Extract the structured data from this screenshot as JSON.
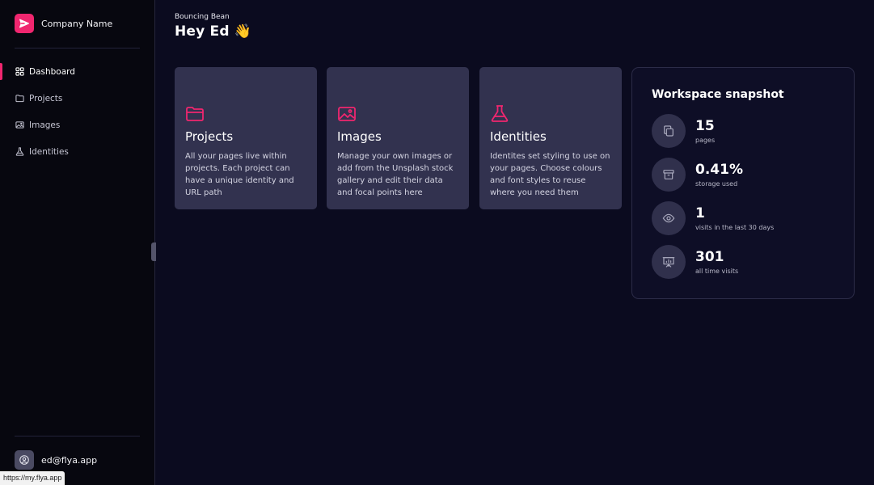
{
  "brand": {
    "name": "Company Name",
    "logo_icon": "send-icon",
    "accent": "#f0266f"
  },
  "nav": {
    "items": [
      {
        "label": "Dashboard",
        "icon": "grid-icon",
        "active": true
      },
      {
        "label": "Projects",
        "icon": "folder-icon"
      },
      {
        "label": "Images",
        "icon": "image-icon"
      },
      {
        "label": "Identities",
        "icon": "flask-icon"
      }
    ]
  },
  "user": {
    "email": "ed@flya.app"
  },
  "status_bar": {
    "url": "https://my.flya.app"
  },
  "header": {
    "workspace": "Bouncing Bean",
    "greeting": "Hey Ed 👋"
  },
  "cards": [
    {
      "title": "Projects",
      "icon": "folder-icon",
      "description": "All your pages live within projects. Each project can have a unique identity and URL path"
    },
    {
      "title": "Images",
      "icon": "image-icon",
      "description": "Manage your own images or add from the Unsplash stock gallery and edit their data and focal points here"
    },
    {
      "title": "Identities",
      "icon": "flask-icon",
      "description": "Identites set styling to use on your pages. Choose colours and font styles to reuse where you need them"
    }
  ],
  "snapshot": {
    "title": "Workspace snapshot",
    "stats": [
      {
        "value": "15",
        "label": "pages",
        "icon": "copy-icon"
      },
      {
        "value": "0.41%",
        "label": "storage used",
        "icon": "archive-icon"
      },
      {
        "value": "1",
        "label": "visits in the last 30 days",
        "icon": "eye-icon"
      },
      {
        "value": "301",
        "label": "all time visits",
        "icon": "presentation-icon"
      }
    ]
  }
}
